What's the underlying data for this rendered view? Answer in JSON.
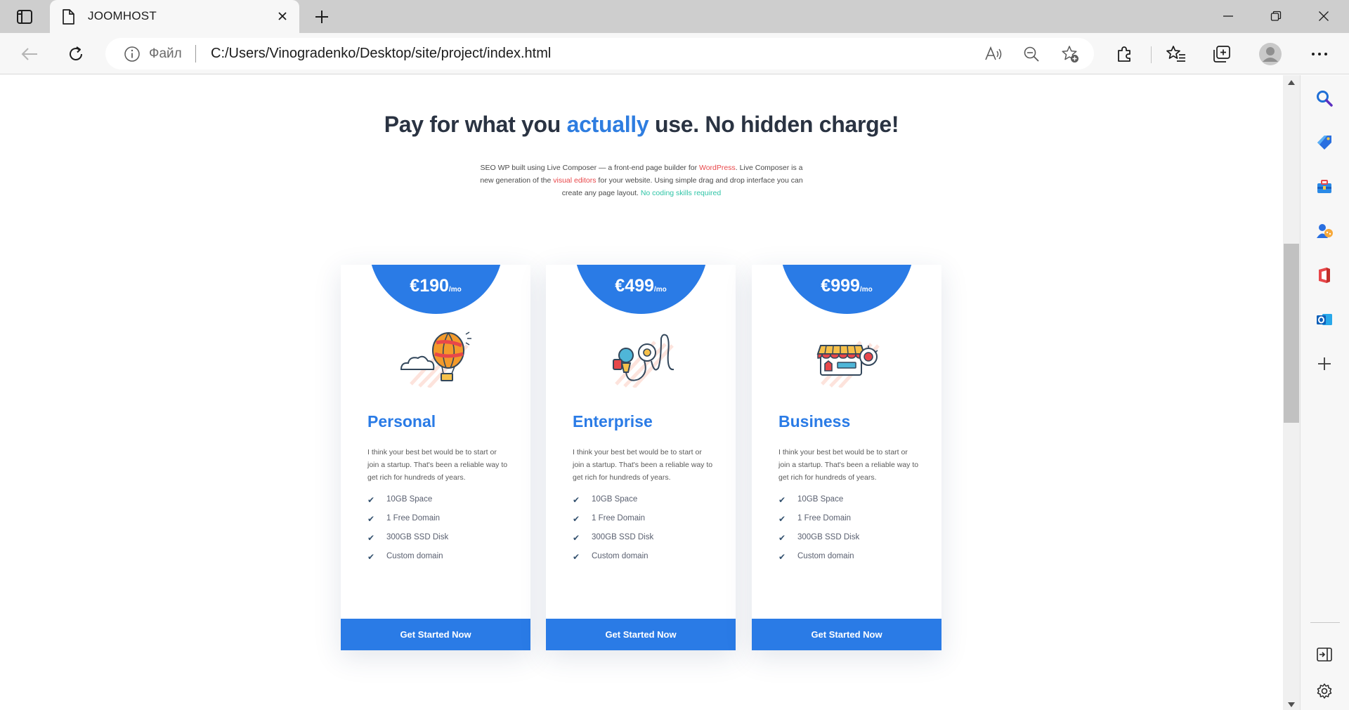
{
  "browser": {
    "tab": {
      "title": "JOOMHOST",
      "icon": "document-icon"
    },
    "address": {
      "scheme_label": "Файл",
      "url": "C:/Users/Vinogradenko/Desktop/site/project/index.html"
    },
    "toolbar_icons": [
      "back-arrow-icon",
      "refresh-icon",
      "info-icon",
      "read-aloud-icon",
      "zoom-out-icon",
      "add-favorite-icon",
      "extensions-icon",
      "favorites-icon",
      "collections-icon",
      "profile-avatar",
      "more-menu-icon"
    ],
    "sidebar_icons": [
      "search-icon",
      "shopping-tag-icon",
      "tools-icon",
      "games-icon",
      "office-icon",
      "outlook-icon",
      "add-icon",
      "hide-sidebar-icon",
      "settings-icon"
    ]
  },
  "page": {
    "heading": {
      "before": "Pay for what you ",
      "accent": "actually",
      "after": " use. No hidden charge!"
    },
    "intro": {
      "p1": "SEO WP built using Live Composer — a front-end page builder for ",
      "link1": "WordPress",
      "p2": ". Live Composer is a new generation of the ",
      "link2": "visual editors",
      "p3": " for your website. Using simple drag and drop interface you can create any page layout. ",
      "link3": "No coding skills required"
    },
    "plans": [
      {
        "price": "€190",
        "period": "/mo",
        "name": "Personal",
        "illustration": "hot-air-balloon-icon",
        "description": "I think your best bet would be to start or join a startup. That's been a reliable way to get rich for hundreds of years.",
        "features": [
          "10GB Space",
          "1 Free Domain",
          "300GB SSD Disk",
          "Custom domain"
        ],
        "cta": "Get Started Now"
      },
      {
        "price": "€499",
        "period": "/mo",
        "name": "Enterprise",
        "illustration": "microphone-camera-icon",
        "description": "I think your best bet would be to start or join a startup. That's been a reliable way to get rich for hundreds of years.",
        "features": [
          "10GB Space",
          "1 Free Domain",
          "300GB SSD Disk",
          "Custom domain"
        ],
        "cta": "Get Started Now"
      },
      {
        "price": "€999",
        "period": "/mo",
        "name": "Business",
        "illustration": "online-store-icon",
        "description": "I think your best bet would be to start or join a startup. That's been a reliable way to get rich for hundreds of years.",
        "features": [
          "10GB Space",
          "1 Free Domain",
          "300GB SSD Disk",
          "Custom domain"
        ],
        "cta": "Get Started Now"
      }
    ]
  },
  "colors": {
    "accent": "#2a7be6",
    "heading": "#2a3342",
    "link_red": "#e8474a",
    "link_teal": "#2ec4a6"
  }
}
